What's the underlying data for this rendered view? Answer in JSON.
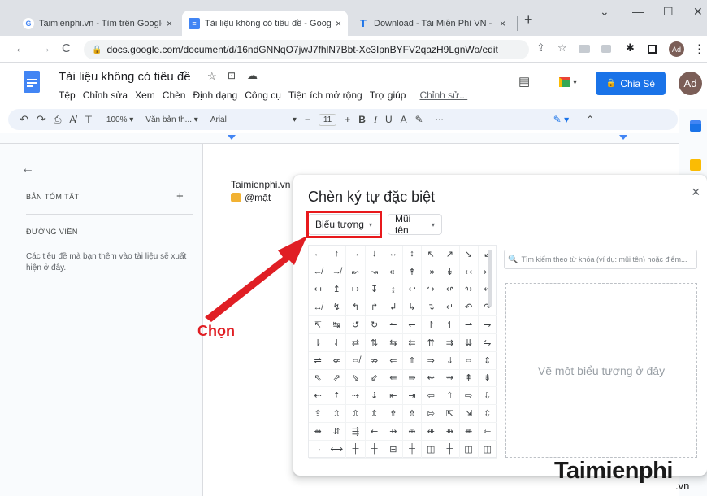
{
  "browser": {
    "tabs": [
      {
        "title": "Taimienphi.vn - Tìm trên Google",
        "close": "×"
      },
      {
        "title": "Tài liệu không có tiêu đề - Google",
        "close": "×"
      },
      {
        "title": "Download - Tải Miễn Phí VN - Ph",
        "close": "×"
      }
    ],
    "new_tab": "+",
    "win_down": "⌄",
    "win_min": "—",
    "win_max": "☐",
    "win_close": "✕",
    "url": "docs.google.com/document/d/16ndGNNqO7jwJ7fhlN7Bbt-Xe3IpnBYFV2qazH9LgnWo/edit",
    "profile": "Ad"
  },
  "doc": {
    "title": "Tài liệu không có tiêu đề",
    "menu": [
      "Tệp",
      "Chỉnh sửa",
      "Xem",
      "Chèn",
      "Định dạng",
      "Công cụ",
      "Tiện ích mở rộng",
      "Trợ giúp",
      "Chỉnh sử..."
    ],
    "share": "Chia Sẻ",
    "avatar": "Ad"
  },
  "toolbar": {
    "zoom": "100%",
    "style": "Văn bản th...",
    "font": "Arial",
    "size": "11"
  },
  "outline": {
    "summary": "BẢN TÓM TẮT",
    "add": "+",
    "heading": "ĐƯỜNG VIỀN",
    "hint": "Các tiêu đề mà bạn thêm vào tài liệu sẽ xuất hiện ở đây."
  },
  "page": {
    "line1": "Taimienphi.vn",
    "line2": "@mặt"
  },
  "dialog": {
    "title": "Chèn ký tự đặc biệt",
    "close": "×",
    "category": "Biểu tượng",
    "subcategory": "Mũi tên",
    "search_placeholder": "Tìm kiếm theo từ khóa (ví dụ: mũi tên) hoặc điểm...",
    "draw_hint": "Vẽ một biểu tượng ở đây",
    "symbols": [
      "←",
      "↑",
      "→",
      "↓",
      "↔",
      "↕",
      "↖",
      "↗",
      "↘",
      "↙",
      "↚",
      "↛",
      "↜",
      "↝",
      "↞",
      "↟",
      "↠",
      "↡",
      "↢",
      "↣",
      "↤",
      "↥",
      "↦",
      "↧",
      "↨",
      "↩",
      "↪",
      "↫",
      "↬",
      "↭",
      "↮",
      "↯",
      "↰",
      "↱",
      "↲",
      "↳",
      "↴",
      "↵",
      "↶",
      "↷",
      "↸",
      "↹",
      "↺",
      "↻",
      "↼",
      "↽",
      "↾",
      "↿",
      "⇀",
      "⇁",
      "⇂",
      "⇃",
      "⇄",
      "⇅",
      "⇆",
      "⇇",
      "⇈",
      "⇉",
      "⇊",
      "⇋",
      "⇌",
      "⇍",
      "⇎",
      "⇏",
      "⇐",
      "⇑",
      "⇒",
      "⇓",
      "⇔",
      "⇕",
      "⇖",
      "⇗",
      "⇘",
      "⇙",
      "⇚",
      "⇛",
      "⇜",
      "⇝",
      "⇞",
      "⇟",
      "⇠",
      "⇡",
      "⇢",
      "⇣",
      "⇤",
      "⇥",
      "⇦",
      "⇧",
      "⇨",
      "⇩",
      "⇪",
      "⇫",
      "⇬",
      "⇭",
      "⇮",
      "⇯",
      "⇰",
      "⇱",
      "⇲",
      "⇳",
      "⇴",
      "⇵",
      "⇶",
      "⇷",
      "⇸",
      "⇹",
      "⇺",
      "⇻",
      "⇼",
      "⇽",
      "→",
      "⟷",
      "┼",
      "┼",
      "⊟",
      "┼",
      "◫",
      "┼",
      "◫",
      "◫"
    ]
  },
  "annotation": {
    "label": "Chọn",
    "color": "#e01e24"
  },
  "watermark": {
    "brand": "Taimienphi",
    "suffix": ".vn"
  }
}
